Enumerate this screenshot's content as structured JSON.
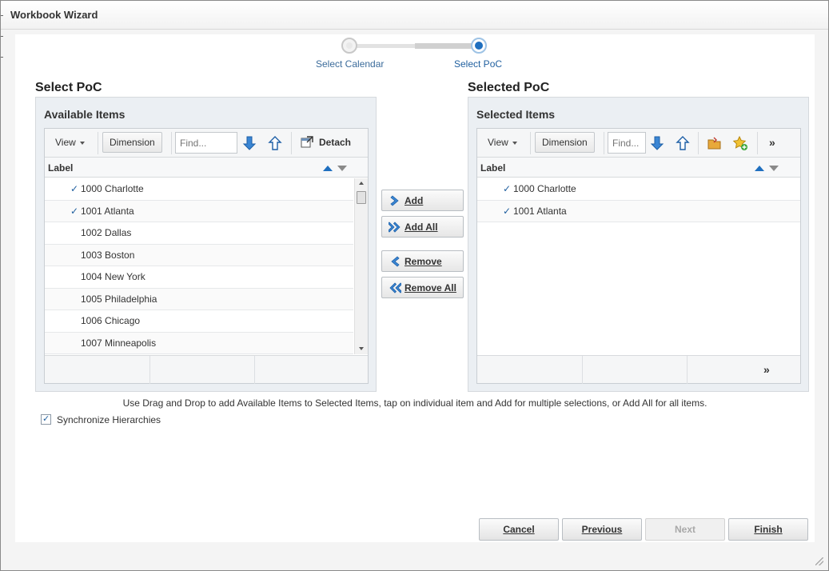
{
  "window": {
    "title": "Workbook Wizard"
  },
  "train": {
    "steps": [
      {
        "label": "Select Calendar",
        "state": "visited"
      },
      {
        "label": "Select PoC",
        "state": "current"
      }
    ]
  },
  "available": {
    "section_title": "Select PoC",
    "panel_title": "Available Items",
    "toolbar": {
      "view_label": "View",
      "dimension_label": "Dimension",
      "find_placeholder": "Find...",
      "detach_label": "Detach"
    },
    "column_label": "Label",
    "items": [
      {
        "label": "1000 Charlotte",
        "checked": true
      },
      {
        "label": "1001 Atlanta",
        "checked": true
      },
      {
        "label": "1002 Dallas",
        "checked": false
      },
      {
        "label": "1003 Boston",
        "checked": false
      },
      {
        "label": "1004 New York",
        "checked": false
      },
      {
        "label": "1005 Philadelphia",
        "checked": false
      },
      {
        "label": "1006 Chicago",
        "checked": false
      },
      {
        "label": "1007 Minneapolis",
        "checked": false
      }
    ]
  },
  "selected": {
    "section_title": "Selected PoC",
    "panel_title": "Selected Items",
    "toolbar": {
      "view_label": "View",
      "dimension_label": "Dimension",
      "find_placeholder": "Find...",
      "more_label": "»"
    },
    "column_label": "Label",
    "items": [
      {
        "label": "1000 Charlotte",
        "checked": true
      },
      {
        "label": "1001 Atlanta",
        "checked": true
      }
    ],
    "footer_more": "»"
  },
  "shuttle": {
    "add": "Add",
    "add_all": "Add All",
    "remove": "Remove",
    "remove_all": "Remove All"
  },
  "hint": "Use Drag and Drop to add Available Items to Selected Items, tap on individual item and Add for multiple selections, or Add All for all items.",
  "sync": {
    "label": "Synchronize Hierarchies",
    "checked": true
  },
  "nav": {
    "cancel": "Cancel",
    "previous": "Previous",
    "next": "Next",
    "finish": "Finish"
  },
  "colors": {
    "accent": "#1f6fbf",
    "train_label": "#3c6c9b",
    "panel_bg": "#ebeff3"
  }
}
